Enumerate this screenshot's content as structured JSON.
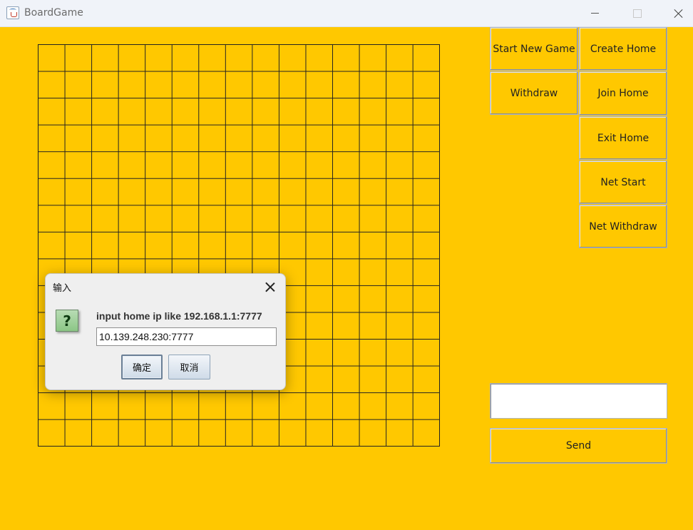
{
  "window": {
    "title": "BoardGame"
  },
  "board": {
    "columns": 15,
    "rows": 15
  },
  "controls": {
    "start_new_game": "Start New Game",
    "create_home": "Create Home",
    "withdraw": "Withdraw",
    "join_home": "Join Home",
    "exit_home": "Exit Home",
    "net_start": "Net Start",
    "net_withdraw": "Net Withdraw",
    "send": "Send"
  },
  "chat": {
    "message_value": ""
  },
  "dialog": {
    "title": "输入",
    "icon": "question-icon",
    "message": "input home ip like 192.168.1.1:7777",
    "input_value": "10.139.248.230:7777",
    "ok_label": "确定",
    "cancel_label": "取消"
  },
  "colors": {
    "background": "#ffc800",
    "grid_line": "#222222"
  }
}
